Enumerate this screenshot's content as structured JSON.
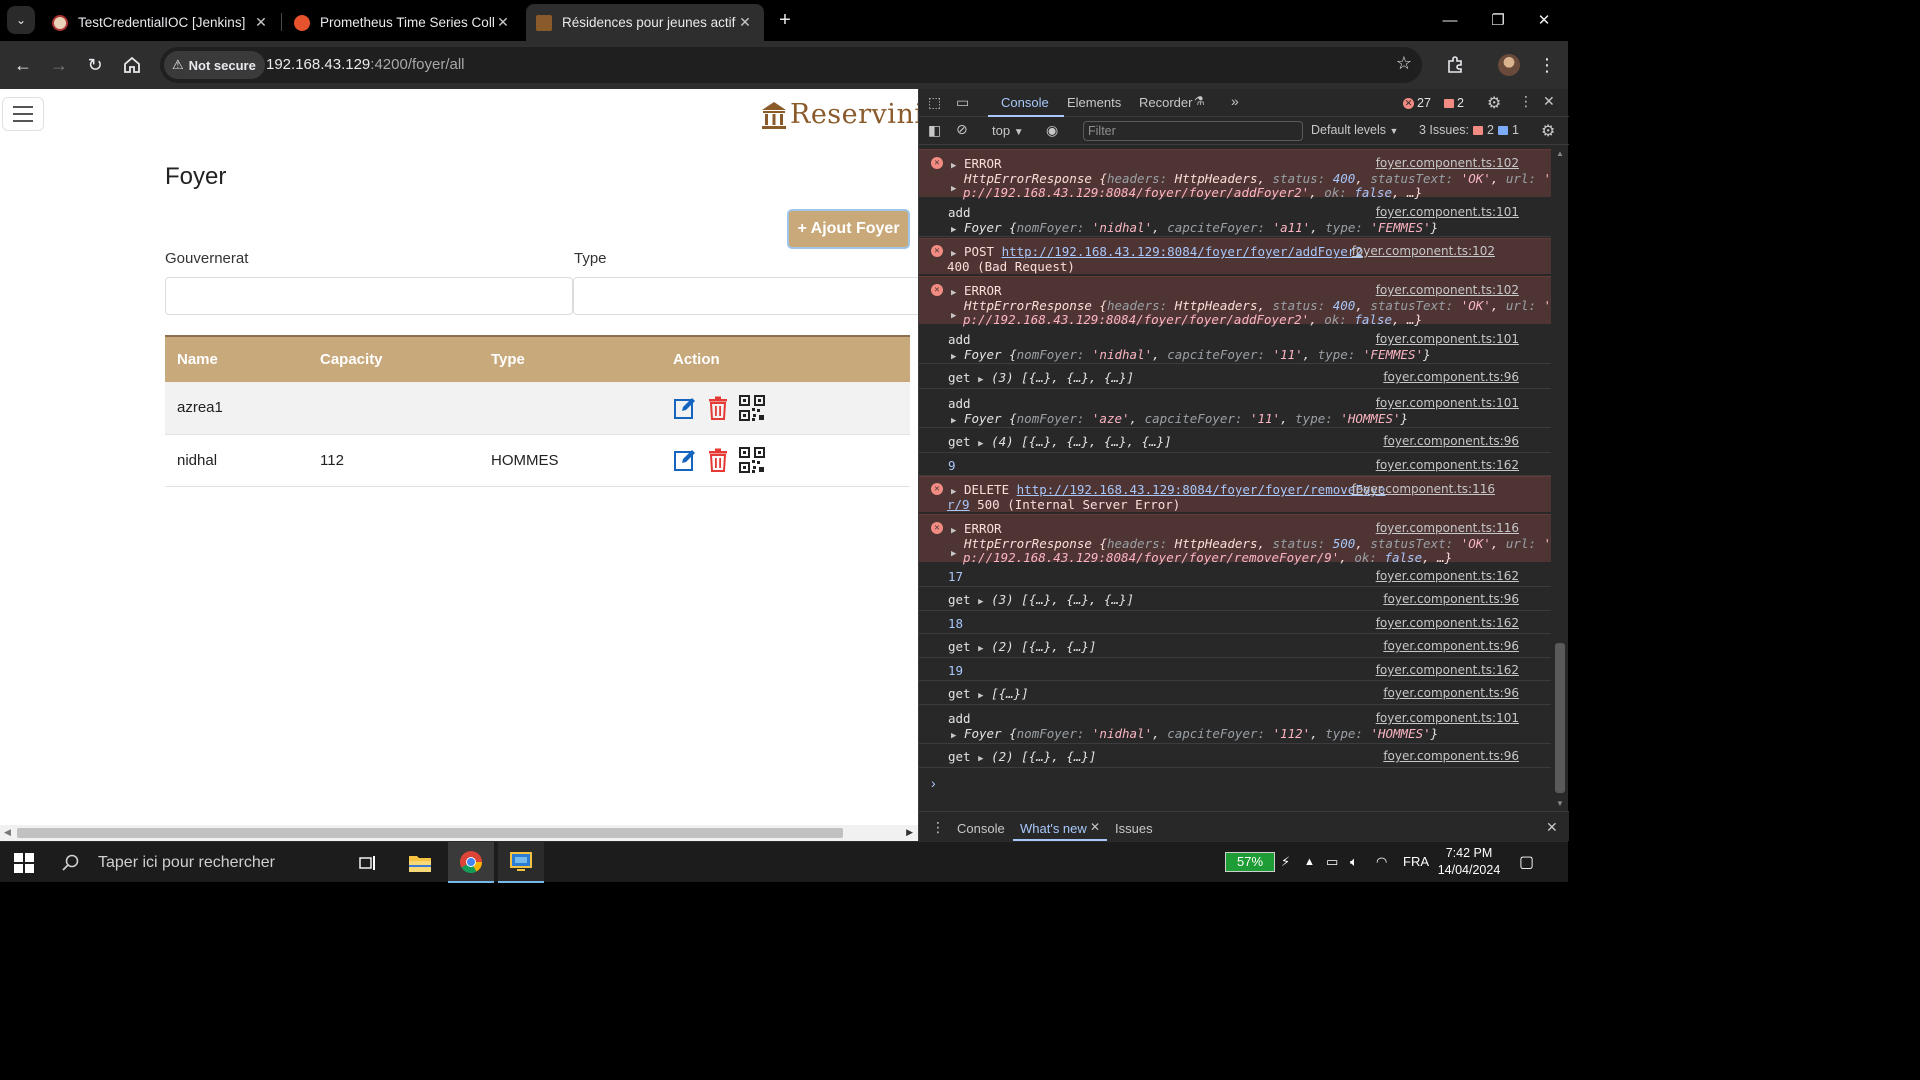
{
  "browser": {
    "tabs": [
      {
        "title": "TestCredentialIOC [Jenkins]",
        "icon": "jenkins-icon"
      },
      {
        "title": "Prometheus Time Series Collect",
        "icon": "prometheus-icon"
      },
      {
        "title": "Résidences pour jeunes actifs et",
        "icon": "reservini-icon",
        "active": true
      }
    ],
    "security_label": "Not secure",
    "url_host": "192.168.43.129",
    "url_rest": ":4200/foyer/all"
  },
  "app": {
    "brand": "Reservini",
    "page_title": "Foyer",
    "add_button": "+ Ajout Foyer",
    "filters": {
      "gouvernerat_label": "Gouvernerat",
      "type_label": "Type"
    },
    "table": {
      "headers": [
        "Name",
        "Capacity",
        "Type",
        "Action"
      ],
      "rows": [
        {
          "name": "azrea1",
          "capacity": "",
          "type": ""
        },
        {
          "name": "nidhal",
          "capacity": "112",
          "type": "HOMMES"
        }
      ]
    }
  },
  "devtools": {
    "tabs": [
      "Console",
      "Elements",
      "Recorder"
    ],
    "error_count": "27",
    "issue_count": "2",
    "context": "top",
    "filter_placeholder": "Filter",
    "levels": "Default levels",
    "issues_label": "3 Issues:",
    "issues_errors": "2",
    "issues_info": "1",
    "drawer_tabs": [
      "Console",
      "What's new",
      "Issues"
    ]
  },
  "taskbar": {
    "search_placeholder": "Taper ici pour rechercher",
    "battery": "57%",
    "language": "FRA",
    "time": "7:42 PM",
    "date": "14/04/2024"
  },
  "colors": {
    "accent": "#c8a97b",
    "brand": "#8b5a2b",
    "edit": "#1565c0",
    "delete": "#e53935"
  }
}
